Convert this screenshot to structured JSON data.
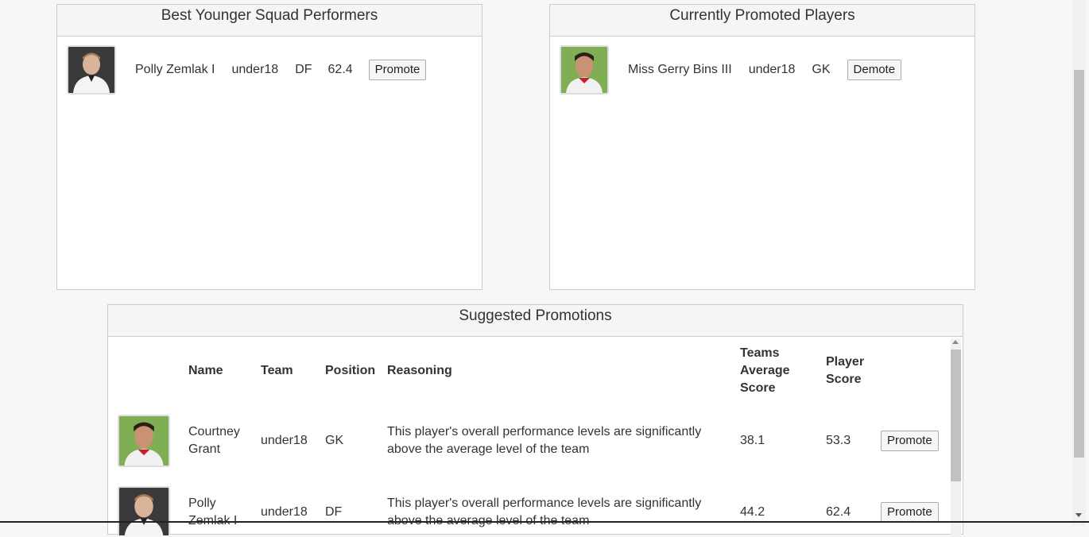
{
  "panels": {
    "best_younger": {
      "title": "Best Younger Squad Performers",
      "player": {
        "name": "Polly Zemlak I",
        "team": "under18",
        "position": "DF",
        "score": "62.4",
        "action": "Promote"
      }
    },
    "promoted": {
      "title": "Currently Promoted Players",
      "player": {
        "name": "Miss Gerry Bins III",
        "team": "under18",
        "position": "GK",
        "action": "Demote"
      }
    }
  },
  "suggested": {
    "title": "Suggested Promotions",
    "columns": {
      "name": "Name",
      "team": "Team",
      "position": "Position",
      "reasoning": "Reasoning",
      "teams_avg_l1": "Teams",
      "teams_avg_l2": "Average",
      "teams_avg_l3": "Score",
      "player_score_l1": "Player",
      "player_score_l2": "Score"
    },
    "rows": [
      {
        "name_l1": "Courtney",
        "name_l2": "Grant",
        "team": "under18",
        "position": "GK",
        "reason_l1": "This player's overall performance levels are significantly",
        "reason_l2": "above the average level of the team",
        "team_avg": "38.1",
        "player_score": "53.3",
        "action": "Promote"
      },
      {
        "name_l1": "Polly",
        "name_l2": "Zemlak I",
        "team": "under18",
        "position": "DF",
        "reason_l1": "This player's overall performance levels are significantly",
        "reason_l2": "above the average level of the team",
        "team_avg": "44.2",
        "player_score": "62.4",
        "action": "Promote"
      }
    ]
  }
}
